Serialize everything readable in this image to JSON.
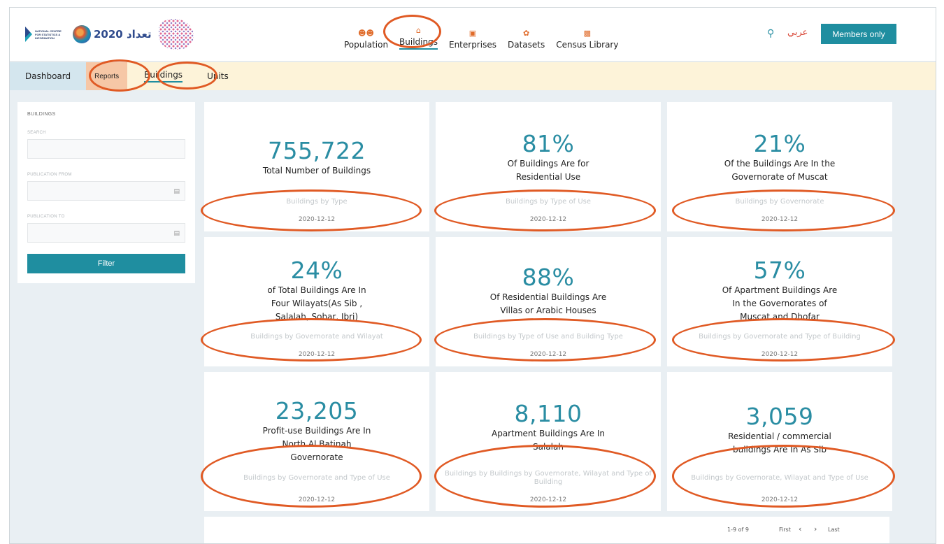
{
  "header": {
    "ncsi_logo_text": "NATIONAL CENTRE FOR STATISTICS & INFORMATION",
    "census_logo_text": "تعداد 2020",
    "nav": [
      {
        "label": "Population",
        "icon": "people-icon"
      },
      {
        "label": "Buildings",
        "icon": "house-icon"
      },
      {
        "label": "Enterprises",
        "icon": "factory-icon"
      },
      {
        "label": "Datasets",
        "icon": "dataset-icon"
      },
      {
        "label": "Census Library",
        "icon": "library-icon"
      }
    ],
    "arabic_label": "عربي",
    "members_label": "Members only"
  },
  "subnav": {
    "dashboard": "Dashboard",
    "reports": "Reports",
    "buildings": "Buildings",
    "units": "Units"
  },
  "sidebar": {
    "title": "BUILDINGS",
    "search_label": "SEARCH",
    "from_label": "PUBLICATION FROM",
    "to_label": "PUBLICATION TO",
    "filter_label": "Filter"
  },
  "cards": [
    {
      "value": "755,722",
      "desc": "Total Number of Buildings",
      "category": "Buildings by Type",
      "date": "2020-12-12"
    },
    {
      "value": "81%",
      "desc": "Of Buildings Are for Residential Use",
      "category": "Buildings by Type of Use",
      "date": "2020-12-12"
    },
    {
      "value": "21%",
      "desc": "Of the Buildings Are In the Governorate of Muscat",
      "category": "Buildings by Governorate",
      "date": "2020-12-12"
    },
    {
      "value": "24%",
      "desc": "of Total Buildings Are In Four Wilayats(As Sib , Salalah, Sohar, Ibri)",
      "category": "Buildings by Governorate and Wilayat",
      "date": "2020-12-12"
    },
    {
      "value": "88%",
      "desc": "Of Residential Buildings Are Villas or Arabic Houses",
      "category": "Buildings by Type of Use and Building Type",
      "date": "2020-12-12"
    },
    {
      "value": "57%",
      "desc": "Of Apartment Buildings Are In the Governorates of Muscat and Dhofar",
      "category": "Buildings by Governorate and Type of Building",
      "date": "2020-12-12"
    },
    {
      "value": "23,205",
      "desc": "Profit-use Buildings Are In North Al Batinah Governorate",
      "category": "Buildings by Governorate and Type of Use",
      "date": "2020-12-12"
    },
    {
      "value": "8,110",
      "desc": "Apartment Buildings Are In Salalah",
      "category": "Buildings by Buildings by Governorate, Wilayat and Type of Building",
      "date": "2020-12-12"
    },
    {
      "value": "3,059",
      "desc": "Residential / commercial buildings Are In As Sib",
      "category": "Buildings by Governorate, Wilayat and Type of Use",
      "date": "2020-12-12"
    }
  ],
  "pager": {
    "count": "1-9 of 9",
    "first": "First",
    "prev": "‹",
    "next": "›",
    "last": "Last"
  },
  "colors": {
    "accent": "#1f8ea0",
    "highlight_oval": "#e05a24",
    "subnav_bg": "#fdf3d9"
  }
}
